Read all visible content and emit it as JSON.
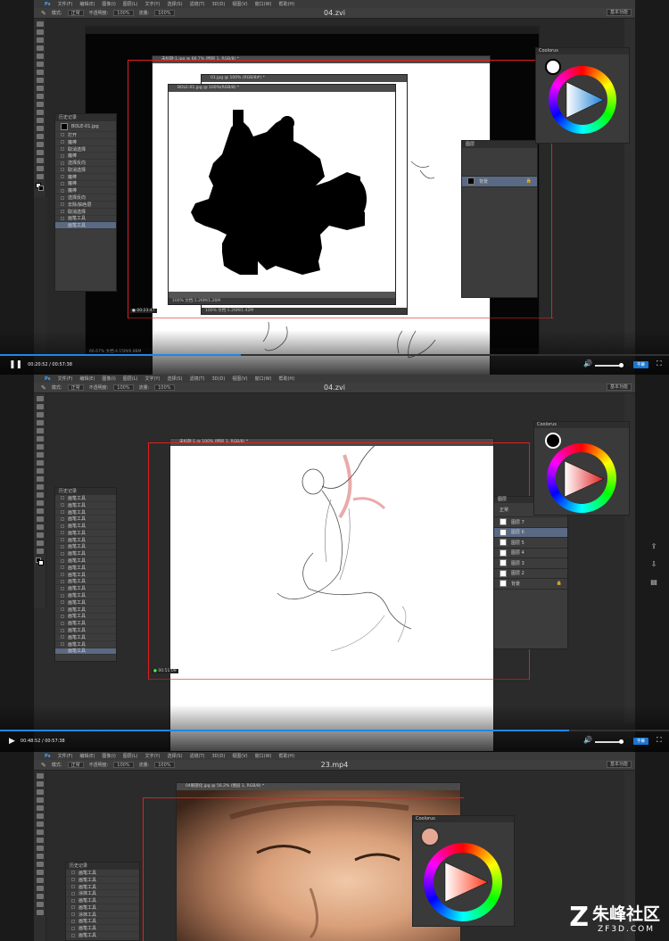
{
  "menu_items": [
    "Ps",
    "文件(F)",
    "编辑(E)",
    "图像(I)",
    "图层(L)",
    "文字(Y)",
    "选择(S)",
    "滤镜(T)",
    "3D(D)",
    "视图(V)",
    "窗口(W)",
    "帮助(H)"
  ],
  "options": {
    "mode_label": "模式:",
    "mode_value": "正常",
    "opacity_label": "不透明度:",
    "opacity_value": "100%",
    "flow_label": "流量:",
    "flow_value": "100%"
  },
  "workspace": "基本功能",
  "coolorus_title": "Coolorus",
  "history_title": "历史记录",
  "subtitle_btn": "字幕",
  "videos": [
    {
      "title": "04.zvi",
      "time": "00:20:52 / 00:57:38",
      "progress": 0.36,
      "status_main": "66.67%  文档:4.15M/6.88M",
      "doc1_title": "未标题-1.jpg @ 66.7% (图层 1, RGB/8) *",
      "doc2_title": "01.jpg @ 100% (RGB/8#) *",
      "doc3_title": "BOLE-01.jpg @ 100%(RGB/8) *",
      "doc3_status": "100%       文档:1.26M/1.26M",
      "doc2_status": "100%       文档:1.26M/1.42M",
      "history_doc": "BOLE-01.jpg",
      "history_items": [
        "打开",
        "魔棒",
        "取消选择",
        "魔棒",
        "选择反向",
        "取消选择",
        "魔棒",
        "魔棒",
        "魔棒",
        "选择反向",
        "去除/抽色层",
        "取消选择",
        "画笔工具",
        "画笔工具"
      ],
      "layers_title": "图层",
      "layer_name": "背景",
      "rec_time": "00:23:47"
    },
    {
      "title": "04.zvi",
      "time": "00:48:52 / 00:57:38",
      "progress": 0.85,
      "doc_title": "未标题-1 @ 100% (图层 1, RGB/8) *",
      "history_items": [
        "画笔工具",
        "画笔工具",
        "画笔工具",
        "画笔工具",
        "画笔工具",
        "画笔工具",
        "画笔工具",
        "画笔工具",
        "画笔工具",
        "画笔工具",
        "画笔工具",
        "画笔工具",
        "画笔工具",
        "画笔工具",
        "画笔工具",
        "画笔工具",
        "画笔工具",
        "画笔工具",
        "画笔工具",
        "画笔工具",
        "画笔工具",
        "画笔工具",
        "画笔工具"
      ],
      "layers_title": "图层",
      "layer_mode": "正常",
      "layers": [
        "图层 7",
        "图层 6",
        "图层 5",
        "图层 4",
        "图层 3",
        "图层 2",
        "背景"
      ],
      "rec_time": "00:51:09"
    },
    {
      "title": "23.mp4",
      "doc_title": "04眼部化.jpg @ 56.2% (图层 1, RGB/8) *",
      "history_items": [
        "画笔工具",
        "画笔工具",
        "画笔工具",
        "涂抹工具",
        "画笔工具",
        "画笔工具",
        "涂抹工具",
        "画笔工具",
        "画笔工具",
        "画笔工具"
      ]
    }
  ],
  "site_name": "朱峰社区",
  "site_url": "ZF3D.COM",
  "colors": {
    "accent": "#1e88e5",
    "red_frame": "#e02020",
    "ui_dark": "#2b2b2b"
  }
}
